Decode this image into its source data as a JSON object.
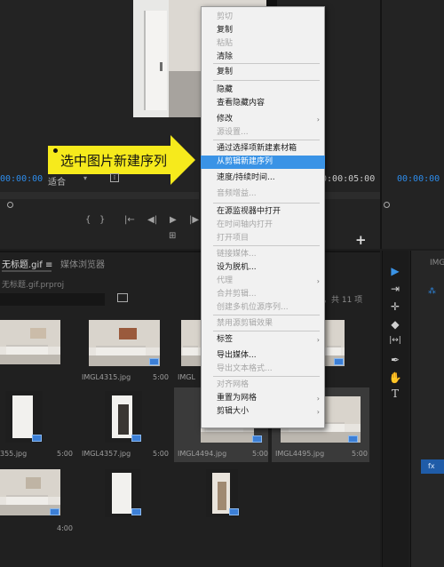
{
  "source_monitor": {
    "fit_label": "适合",
    "fit_chevron": "▾",
    "quality_icon": "⁞",
    "timecode_left": "00:00:00",
    "timecode_right": "00:00:05:00"
  },
  "program_monitor": {
    "timecode": "00:00:00"
  },
  "transport_controls": [
    "{",
    "}",
    "|←",
    "◀|",
    "▶",
    "|▶",
    "→|",
    "⊞"
  ],
  "annotation": {
    "text": "选中图片新建序列"
  },
  "project_panel": {
    "tab_label": "无标题.gif ≡",
    "media_browser_label": "媒体浏览器",
    "path": "无标题.gif.prproj",
    "items_count": "，共 11 项",
    "items": [
      {
        "label": "",
        "duration": "",
        "kind": "room"
      },
      {
        "label": "IMGL4315.jpg",
        "duration": "5:00",
        "kind": "room"
      },
      {
        "label": "IMGL",
        "duration": "",
        "kind": "room"
      },
      {
        "label": "",
        "duration": "",
        "kind": "room"
      },
      {
        "label": "",
        "duration": "5:00",
        "kind": "door"
      },
      {
        "label": "IMGL4357.jpg",
        "duration": "5:00",
        "kind": "door"
      },
      {
        "label": "IMGL4494.jpg",
        "duration": "5:00",
        "kind": "room"
      },
      {
        "label": "IMGL4495.jpg",
        "duration": "5:00",
        "kind": "room"
      },
      {
        "label": "355.jpg",
        "duration": "",
        "kind": "door"
      },
      {
        "label": "",
        "duration": "4:00",
        "kind": "room"
      },
      {
        "label": "",
        "duration": "",
        "kind": "door"
      },
      {
        "label": "",
        "duration": "",
        "kind": "door"
      }
    ]
  },
  "tools": [
    "▶",
    "⇥",
    "✛",
    "◆",
    "|↔|",
    "✒",
    "✋",
    "T"
  ],
  "timeline_panel": {
    "tab": "IMG",
    "marker": "⁂",
    "clip_label": "fx"
  },
  "context_menu": {
    "items": [
      {
        "label": "剪切",
        "disabled": true,
        "submenu": false
      },
      {
        "label": "复制",
        "disabled": false,
        "submenu": false
      },
      {
        "label": "粘贴",
        "disabled": true,
        "submenu": false
      },
      {
        "label": "清除",
        "disabled": false,
        "submenu": false
      },
      {
        "label": "复制",
        "disabled": false,
        "submenu": false
      },
      {
        "label": "隐藏",
        "disabled": false,
        "submenu": false
      },
      {
        "label": "查看隐藏内容",
        "disabled": false,
        "submenu": false
      },
      {
        "label": "修改",
        "disabled": false,
        "submenu": true
      },
      {
        "label": "源设置...",
        "disabled": true,
        "submenu": false
      },
      {
        "label": "通过选择项新建素材箱",
        "disabled": false,
        "submenu": false
      },
      {
        "label": "从剪辑新建序列",
        "disabled": false,
        "submenu": false,
        "highlighted": true
      },
      {
        "label": "速度/持续时间...",
        "disabled": false,
        "submenu": false
      },
      {
        "label": "音频增益...",
        "disabled": true,
        "submenu": false
      },
      {
        "label": "在源监视器中打开",
        "disabled": false,
        "submenu": false
      },
      {
        "label": "在时间轴内打开",
        "disabled": true,
        "submenu": false
      },
      {
        "label": "打开项目",
        "disabled": true,
        "submenu": false
      },
      {
        "label": "链接媒体...",
        "disabled": true,
        "submenu": false
      },
      {
        "label": "设为脱机...",
        "disabled": false,
        "submenu": false
      },
      {
        "label": "代理",
        "disabled": true,
        "submenu": true
      },
      {
        "label": "合并剪辑...",
        "disabled": true,
        "submenu": false
      },
      {
        "label": "创建多机位源序列...",
        "disabled": true,
        "submenu": false
      },
      {
        "label": "禁用源剪辑效果",
        "disabled": true,
        "submenu": false
      },
      {
        "label": "标签",
        "disabled": false,
        "submenu": true
      },
      {
        "label": "导出媒体...",
        "disabled": false,
        "submenu": false
      },
      {
        "label": "导出文本格式...",
        "disabled": true,
        "submenu": false
      },
      {
        "label": "对齐网格",
        "disabled": true,
        "submenu": false
      },
      {
        "label": "重置为网格",
        "disabled": false,
        "submenu": true
      },
      {
        "label": "剪辑大小",
        "disabled": false,
        "submenu": true
      }
    ],
    "submenu_arrow": "›"
  }
}
